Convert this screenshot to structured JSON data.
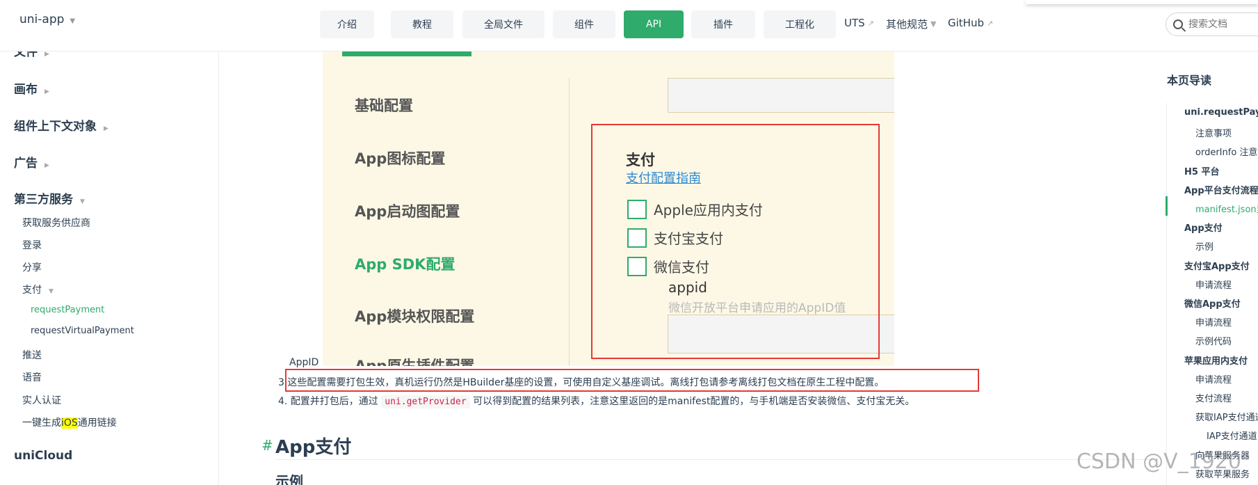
{
  "navbar": {
    "brand": "uni-app",
    "buttons": [
      "介绍",
      "教程",
      "全局文件",
      "组件",
      "API",
      "插件",
      "工程化"
    ],
    "active_button": "API",
    "links": [
      "UTS",
      "其他规范",
      "GitHub"
    ],
    "search_placeholder": "搜索文档"
  },
  "sidebar": {
    "cut_top": "文件",
    "groups": [
      "画布",
      "组件上下文对象",
      "广告",
      "第三方服务"
    ],
    "items": [
      "获取服务供应商",
      "登录",
      "分享",
      "支付"
    ],
    "sub_items": [
      "requestPayment",
      "requestVirtualPayment"
    ],
    "items_after": [
      "推送",
      "语音",
      "实人认证"
    ],
    "ios_link": {
      "prefix": "一键生成",
      "highlight": "iOS",
      "suffix": "通用链接"
    },
    "bottom_group": "uniCloud"
  },
  "panel": {
    "configs": [
      "基础配置",
      "App图标配置",
      "App启动图配置",
      "App SDK配置",
      "App模块权限配置",
      "App原生插件配置"
    ],
    "active_config": "App SDK配置",
    "pay_title": "支付",
    "pay_link": "支付配置指南",
    "checkboxes": [
      "Apple应用内支付",
      "支付宝支付",
      "微信支付"
    ],
    "appid_label": "appid",
    "appid_hint": "微信开放平台申请应用的AppID值"
  },
  "content": {
    "appid_small": "AppID",
    "note3_num": "3.",
    "note3": "这些配置需要打包生效，真机运行仍然是HBuilder基座的设置，可使用自定义基座调试。离线打包请参考离线打包文档在原生工程中配置。",
    "note4_num": "4.",
    "note4_pre": "配置并打包后，通过",
    "note4_code": "uni.getProvider",
    "note4_post": "可以得到配置的结果列表，注意这里返回的是manifest配置的，与手机端是否安装微信、支付宝无关。",
    "heading_anchor": "#",
    "heading": "App支付",
    "subheading": "示例"
  },
  "toc": {
    "title": "本页导读",
    "items": [
      {
        "label": "uni.requestPayment",
        "level": 1
      },
      {
        "label": "注意事项",
        "level": 2
      },
      {
        "label": "orderInfo 注意事项",
        "level": 2
      },
      {
        "label": "H5 平台",
        "level": 1
      },
      {
        "label": "App平台支付流程",
        "level": 1
      },
      {
        "label": "manifest.json里的配置",
        "level": 2
      },
      {
        "label": "App支付",
        "level": 1
      },
      {
        "label": "示例",
        "level": 2
      },
      {
        "label": "支付宝App支付",
        "level": 1
      },
      {
        "label": "申请流程",
        "level": 2
      },
      {
        "label": "微信App支付",
        "level": 1
      },
      {
        "label": "申请流程",
        "level": 2
      },
      {
        "label": "示例代码",
        "level": 2
      },
      {
        "label": "苹果应用内支付",
        "level": 1
      },
      {
        "label": "申请流程",
        "level": 2
      },
      {
        "label": "支付流程",
        "level": 2
      },
      {
        "label": "获取IAP支付通道",
        "level": 2
      },
      {
        "label": "IAP支付通道",
        "level": 3
      },
      {
        "label": "向苹果服务器",
        "level": 2
      },
      {
        "label": "获取苹果服务",
        "level": 2
      }
    ],
    "active_index": 5
  },
  "watermark": "CSDN @V_1920",
  "colors": {
    "accent": "#2fab6c",
    "highlight_box": "#e53935",
    "panel_bg": "#fdf8e6",
    "link": "#2e89d3"
  }
}
